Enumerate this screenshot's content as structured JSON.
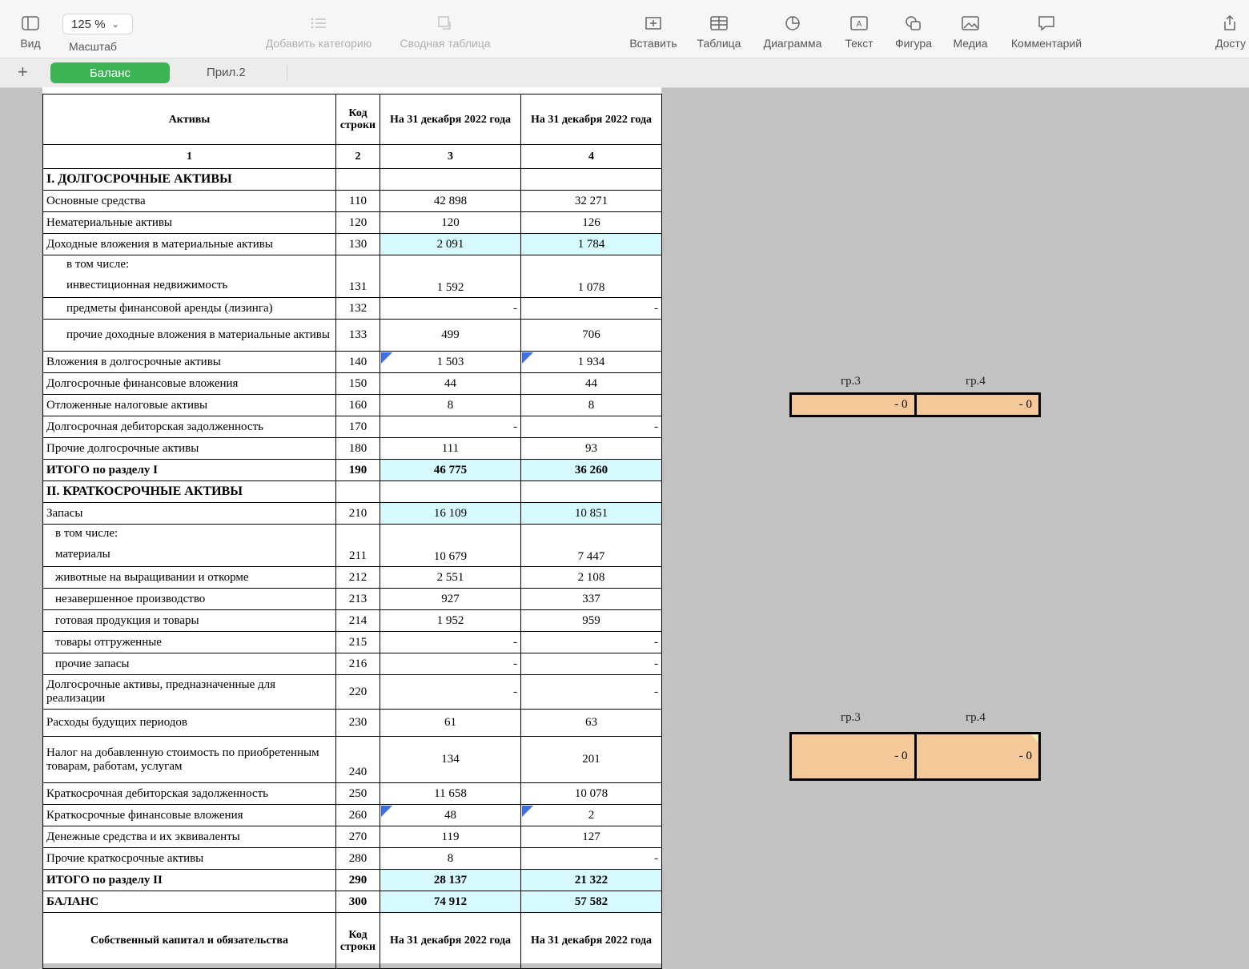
{
  "toolbar": {
    "view": "Вид",
    "zoom_value": "125 %",
    "zoom_label": "Масштаб",
    "add_category": "Добавить категорию",
    "pivot": "Сводная таблица",
    "insert": "Вставить",
    "table": "Таблица",
    "chart": "Диаграмма",
    "text": "Текст",
    "shape": "Фигура",
    "media": "Медиа",
    "comment": "Комментарий",
    "share": "Досту"
  },
  "tabs": {
    "active": "Баланс",
    "other": "Прил.2",
    "add": "+"
  },
  "table": {
    "col_assets": "Активы",
    "col_code": "Код строки",
    "col_date1": "На 31 декабря 2022 года",
    "col_date2": "На 31 декабря 2022 года",
    "num1": "1",
    "num2": "2",
    "num3": "3",
    "num4": "4",
    "rows": [
      {
        "label": "I. ДОЛГОСРОЧНЫЕ АКТИВЫ",
        "code": "",
        "v1": "",
        "v2": ""
      },
      {
        "label": "Основные средства",
        "code": "110",
        "v1": "42 898",
        "v2": "32 271"
      },
      {
        "label": "Нематериальные активы",
        "code": "120",
        "v1": "120",
        "v2": "126"
      },
      {
        "label": "Доходные вложения в материальные активы",
        "code": "130",
        "v1": "2 091",
        "v2": "1 784"
      },
      {
        "label": "в том числе:",
        "label2": "инвестиционная недвижимость",
        "code": "131",
        "v1": "1 592",
        "v2": "1 078"
      },
      {
        "label": "предметы финансовой аренды (лизинга)",
        "code": "132",
        "v1": "-",
        "v2": "-"
      },
      {
        "label": "прочие доходные вложения в материальные активы",
        "code": "133",
        "v1": "499",
        "v2": "706"
      },
      {
        "label": "Вложения в долгосрочные активы",
        "code": "140",
        "v1": "1 503",
        "v2": "1 934"
      },
      {
        "label": "Долгосрочные финансовые вложения",
        "code": "150",
        "v1": "44",
        "v2": "44"
      },
      {
        "label": "Отложенные налоговые активы",
        "code": "160",
        "v1": "8",
        "v2": "8"
      },
      {
        "label": "Долгосрочная дебиторская задолженность",
        "code": "170",
        "v1": "-",
        "v2": "-"
      },
      {
        "label": "Прочие долгосрочные активы",
        "code": "180",
        "v1": "111",
        "v2": "93"
      },
      {
        "label": "ИТОГО по разделу I",
        "code": "190",
        "v1": "46 775",
        "v2": "36 260"
      },
      {
        "label": "II. КРАТКОСРОЧНЫЕ АКТИВЫ",
        "code": "",
        "v1": "",
        "v2": ""
      },
      {
        "label": "Запасы",
        "code": "210",
        "v1": "16 109",
        "v2": "10 851"
      },
      {
        "label": "в том числе:",
        "label2": "материалы",
        "code": "211",
        "v1": "10 679",
        "v2": "7 447"
      },
      {
        "label": "животные на выращивании и откорме",
        "code": "212",
        "v1": "2 551",
        "v2": "2 108"
      },
      {
        "label": "незавершенное производство",
        "code": "213",
        "v1": "927",
        "v2": "337"
      },
      {
        "label": "готовая продукция и товары",
        "code": "214",
        "v1": "1 952",
        "v2": "959"
      },
      {
        "label": "товары отгруженные",
        "code": "215",
        "v1": "-",
        "v2": "-"
      },
      {
        "label": "прочие запасы",
        "code": "216",
        "v1": "-",
        "v2": "-"
      },
      {
        "label": "Долгосрочные активы, предназначенные для реализации",
        "code": "220",
        "v1": "-",
        "v2": "-"
      },
      {
        "label": "Расходы будущих периодов",
        "code": "230",
        "v1": "61",
        "v2": "63"
      },
      {
        "label": "Налог на добавленную стоимость по приобретенным товарам, работам, услугам",
        "code": "240",
        "v1": "134",
        "v2": "201"
      },
      {
        "label": "Краткосрочная дебиторская задолженность",
        "code": "250",
        "v1": "11 658",
        "v2": "10 078"
      },
      {
        "label": "Краткосрочные финансовые вложения",
        "code": "260",
        "v1": "48",
        "v2": "2"
      },
      {
        "label": "Денежные средства и их эквиваленты",
        "code": "270",
        "v1": "119",
        "v2": "127"
      },
      {
        "label": "Прочие краткосрочные активы",
        "code": "280",
        "v1": "8",
        "v2": "-"
      },
      {
        "label": "ИТОГО по разделу II",
        "code": "290",
        "v1": "28 137",
        "v2": "21 322"
      },
      {
        "label": "БАЛАНС",
        "code": "300",
        "v1": "74 912",
        "v2": "57 582"
      }
    ],
    "footer_label": "Собственный капитал и обязательства",
    "footer_code": "Код строки",
    "footer_date1": "На 31 декабря 2022 года",
    "footer_date2": "На 31 декабря 2022 года"
  },
  "checks": [
    {
      "label3": "гр.3",
      "label4": "гр.4",
      "v3": "-  0",
      "v4": "-  0"
    },
    {
      "label3": "гр.3",
      "label4": "гр.4",
      "v3": "-  0",
      "v4": "-  0"
    }
  ],
  "colors": {
    "highlight": "#d6fafd",
    "check_fill": "#f6c99a",
    "tab_active": "#3bb554",
    "marker": "#3e6fe0"
  }
}
